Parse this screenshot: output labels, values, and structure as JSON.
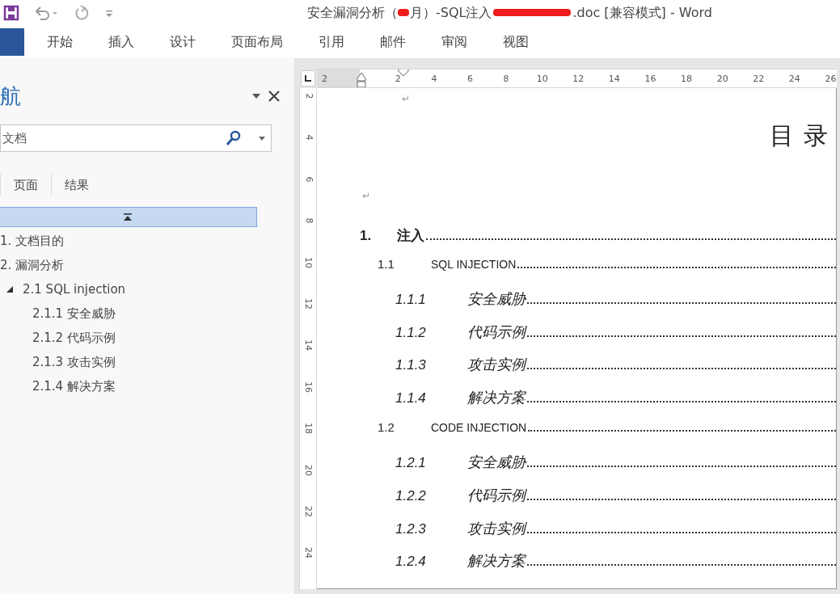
{
  "title_bar": {
    "title_parts": [
      "安全漏洞分析（",
      "月）-SQL注入",
      ".doc [兼容模式] - Word"
    ]
  },
  "ribbon": {
    "tabs": [
      {
        "label": "开始",
        "selected": false
      },
      {
        "label": "插入",
        "selected": false
      },
      {
        "label": "设计",
        "selected": false
      },
      {
        "label": "页面布局",
        "selected": false
      },
      {
        "label": "引用",
        "selected": false
      },
      {
        "label": "邮件",
        "selected": false
      },
      {
        "label": "审阅",
        "selected": false
      },
      {
        "label": "视图",
        "selected": false
      }
    ]
  },
  "navigation": {
    "title": "航",
    "search": {
      "placeholder": "文档"
    },
    "tabs": [
      {
        "label": "页面",
        "selected": false
      },
      {
        "label": "结果",
        "selected": false
      }
    ],
    "headings": [
      {
        "label": "1. 文档目的"
      },
      {
        "label": "2. 漏洞分析",
        "children": [
          {
            "label": "2.1 SQL injection",
            "expanded": true,
            "children": [
              {
                "label": "2.1.1 安全威胁"
              },
              {
                "label": "2.1.2 代码示例"
              },
              {
                "label": "2.1.3 攻击实例"
              },
              {
                "label": "2.1.4 解决方案"
              }
            ]
          }
        ]
      }
    ]
  },
  "ruler": {
    "h_ticks": [
      "2",
      "2",
      "4",
      "6",
      "8",
      "10",
      "12",
      "14",
      "16",
      "18",
      "20",
      "22",
      "24",
      "26"
    ],
    "v_ticks": [
      "2",
      "4",
      "6",
      "8",
      "10",
      "12",
      "14",
      "16",
      "18",
      "20",
      "22",
      "24"
    ]
  },
  "document": {
    "top_mark": "↵",
    "heading": "目 录",
    "heading_mark": "↵",
    "toc": [
      {
        "kind": "chapter",
        "number": "1.",
        "title": "注入"
      },
      {
        "kind": "section",
        "number": "1.1",
        "title": "SQL INJECTION"
      },
      {
        "kind": "subsection",
        "number": "1.1.1",
        "title": "安全威胁"
      },
      {
        "kind": "subsection",
        "number": "1.1.2",
        "title": "代码示例"
      },
      {
        "kind": "subsection",
        "number": "1.1.3",
        "title": "攻击实例"
      },
      {
        "kind": "subsection",
        "number": "1.1.4",
        "title": "解决方案"
      },
      {
        "kind": "section",
        "number": "1.2",
        "title": "CODE INJECTION"
      },
      {
        "kind": "subsection",
        "number": "1.2.1",
        "title": "安全威胁"
      },
      {
        "kind": "subsection",
        "number": "1.2.2",
        "title": "代码示例"
      },
      {
        "kind": "subsection",
        "number": "1.2.3",
        "title": "攻击实例"
      },
      {
        "kind": "subsection",
        "number": "1.2.4",
        "title": "解决方案"
      }
    ]
  }
}
